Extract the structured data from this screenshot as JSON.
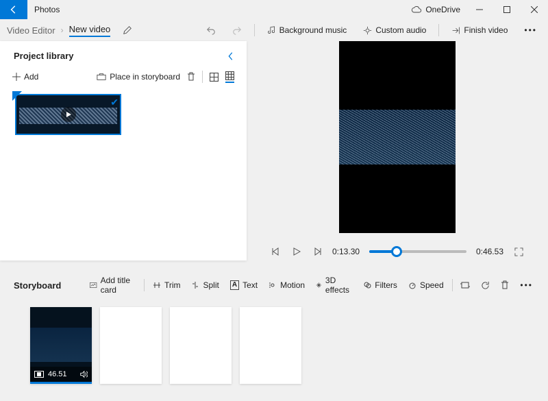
{
  "titlebar": {
    "app_title": "Photos",
    "onedrive_label": "OneDrive"
  },
  "breadcrumb": {
    "root": "Video Editor",
    "current": "New video"
  },
  "toolbar": {
    "undo": "Undo",
    "redo": "Redo",
    "background_music": "Background music",
    "custom_audio": "Custom audio",
    "finish_video": "Finish video"
  },
  "library": {
    "title": "Project library",
    "add_label": "Add",
    "place_label": "Place in storyboard"
  },
  "playback": {
    "current_time": "0:13.30",
    "total_time": "0:46.53"
  },
  "storyboard": {
    "title": "Storyboard",
    "add_title_card": "Add title card",
    "trim": "Trim",
    "split": "Split",
    "text": "Text",
    "motion": "Motion",
    "effects": "3D effects",
    "filters": "Filters",
    "speed": "Speed",
    "clip_duration": "46.51"
  }
}
